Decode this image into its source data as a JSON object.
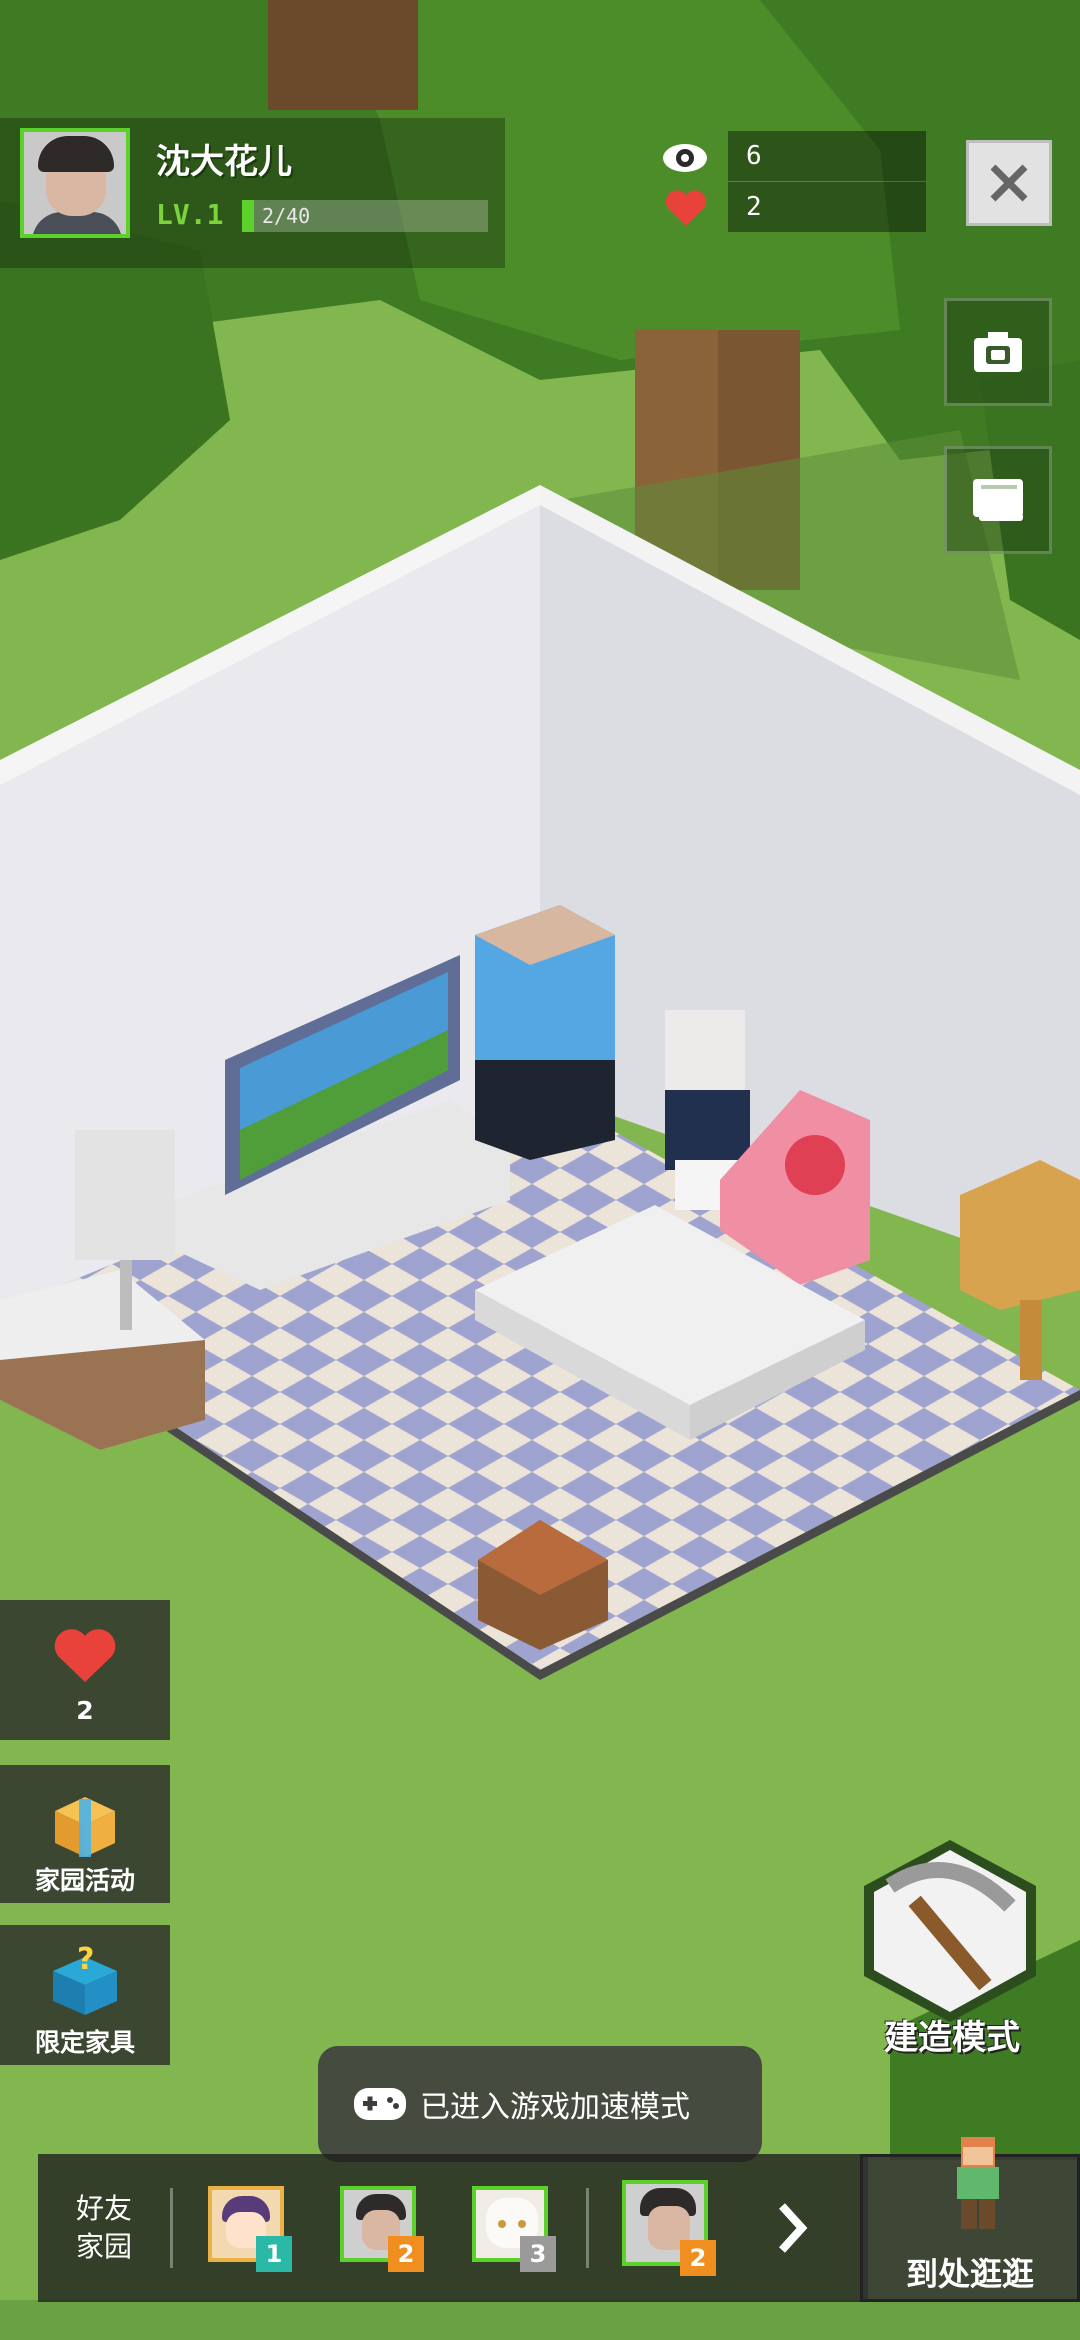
{
  "player": {
    "name": "沈大花儿",
    "level_label": "LV.1",
    "xp_text": "2/40",
    "xp_fraction": 0.05
  },
  "stats": {
    "views": "6",
    "likes": "2"
  },
  "left_menu": {
    "likes_count": "2",
    "home_events_label": "家园活动",
    "limited_furniture_label": "限定家具"
  },
  "build_mode_label": "建造模式",
  "toast": "已进入游戏加速模式",
  "friends": {
    "label": "好友\n家园",
    "items": [
      {
        "badge": "1",
        "badge_color": "#2ab9a6"
      },
      {
        "badge": "2",
        "badge_color": "#f08f1f"
      },
      {
        "badge": "3",
        "badge_color": "#9a9a9a"
      },
      {
        "badge": "2",
        "badge_color": "#f08f1f"
      }
    ]
  },
  "visit_label": "到处逛逛",
  "icons": {
    "views": "eye-icon",
    "likes": "heart-icon",
    "close": "close-icon",
    "camera": "camera-icon",
    "book": "book-icon",
    "next": "chevron-right-icon",
    "toast": "gamepad-icon"
  },
  "colors": {
    "level_green": "#7cd33b",
    "heart_red": "#e8423b"
  }
}
